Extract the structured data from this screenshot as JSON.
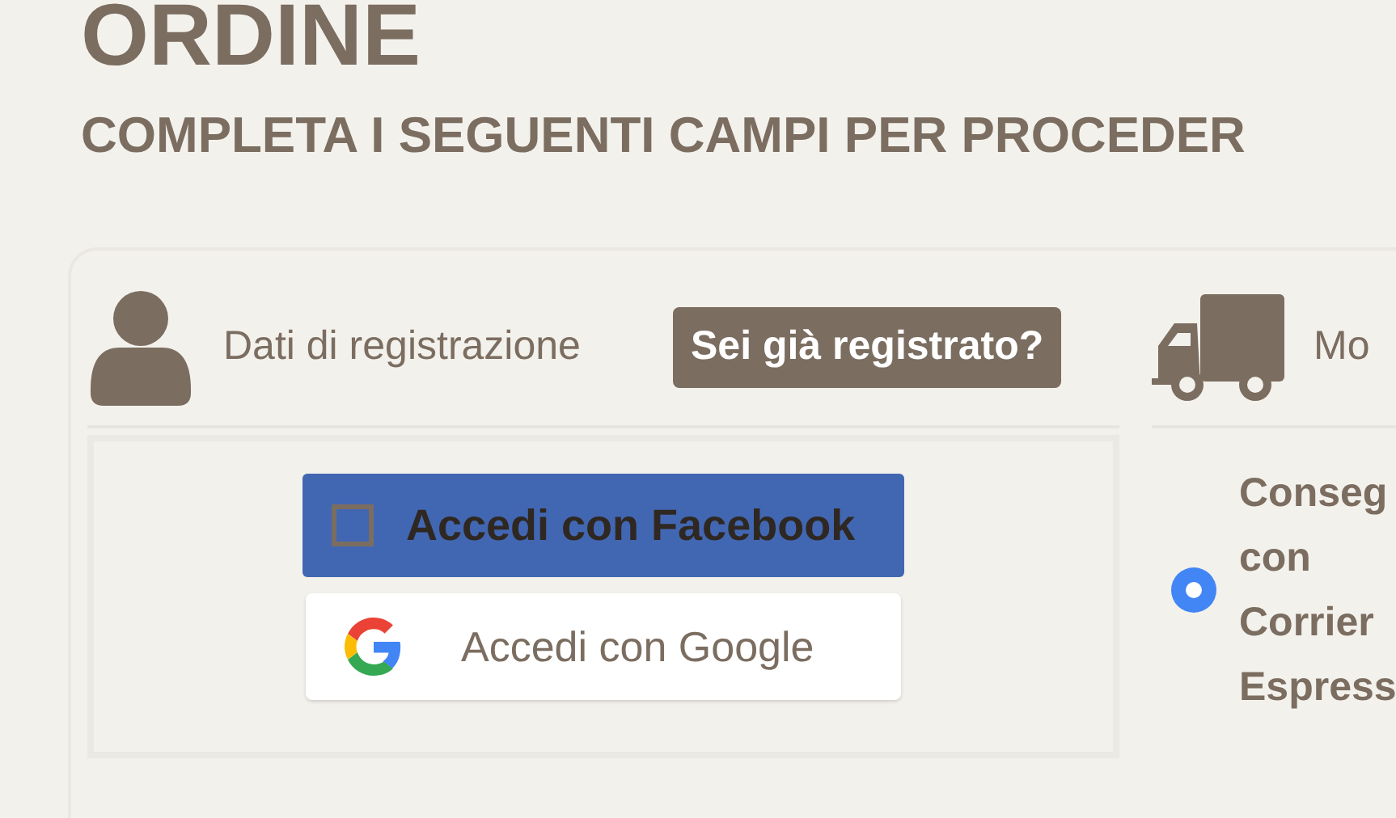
{
  "page": {
    "title": "ORDINE",
    "subtitle": "COMPLETA I SEGUENTI CAMPI PER PROCEDER"
  },
  "registration": {
    "heading": "Dati di registrazione",
    "login_button": "Sei già registrato?",
    "social_buttons": [
      {
        "kind": "facebook",
        "label": "Accedi con Facebook"
      },
      {
        "kind": "google",
        "label": "Accedi con Google"
      }
    ]
  },
  "shipping": {
    "heading": "Mo",
    "options": [
      {
        "label": "Conseg con Corrier Espress",
        "selected": true
      }
    ]
  }
}
